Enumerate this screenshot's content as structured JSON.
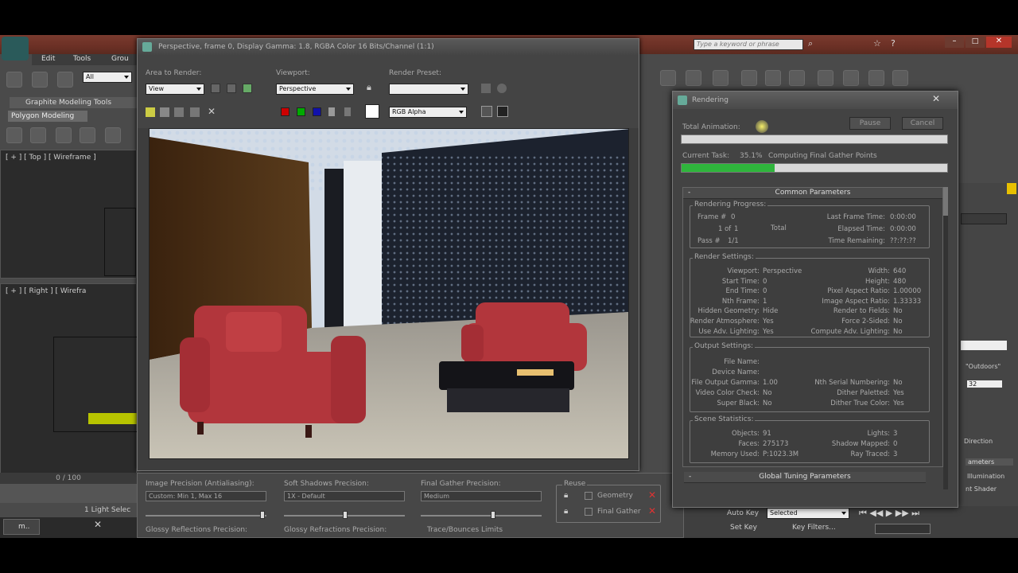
{
  "app": {
    "menu": [
      "Edit",
      "Tools",
      "Grou"
    ],
    "search_placeholder": "Type a keyword or phrase",
    "selection_filter": "All",
    "ribbon_tab": "Graphite Modeling Tools",
    "ribbon_subtab": "Polygon Modeling",
    "viewport_top_label": "[ + ] [ Top ] [ Wireframe ]",
    "viewport_right_label": "[ + ] [ Right ] [ Wirefra",
    "timeline": "0 / 100",
    "status_selected": "1 Light Selec",
    "taskbar_item": "m..",
    "autokey_label": "Auto Key",
    "setkey_label": "Set Key",
    "selected_dropdown": "Selected",
    "key_filters_label": "Key Filters...",
    "right_panel_items": [
      "\"Outdoors\"",
      "32",
      "Direction",
      "ameters",
      "Illumination",
      "nt Shader"
    ]
  },
  "render_frame": {
    "title": "Perspective, frame 0, Display Gamma: 1.8, RGBA Color 16 Bits/Channel (1:1)",
    "area_label": "Area to Render:",
    "area_value": "View",
    "viewport_label": "Viewport:",
    "viewport_value": "Perspective",
    "preset_label": "Render Preset:",
    "preset_value": "",
    "channel_value": "RGB Alpha",
    "image_precision_label": "Image Precision (Antialiasing):",
    "image_precision_value": "Custom: Min 1, Max 16",
    "soft_shadows_label": "Soft Shadows Precision:",
    "soft_shadows_value": "1X - Default",
    "final_gather_label": "Final Gather Precision:",
    "final_gather_value": "Medium",
    "reuse_label": "Reuse",
    "reuse_geometry": "Geometry",
    "reuse_final_gather": "Final Gather",
    "glossy_reflections_label": "Glossy Reflections Precision:",
    "glossy_refractions_label": "Glossy Refractions Precision:",
    "trace_bounces_label": "Trace/Bounces Limits"
  },
  "rendering_dialog": {
    "title": "Rendering",
    "pause_label": "Pause",
    "cancel_label": "Cancel",
    "total_animation_label": "Total Animation:",
    "total_animation_progress": 0.0,
    "current_task_label": "Current Task:",
    "current_task_percent": "35.1%",
    "current_task_name": "Computing Final Gather Points",
    "current_task_progress": 0.35,
    "common_parameters_header": "Common Parameters",
    "global_tuning_header": "Global Tuning Parameters",
    "progress_group": {
      "title": "Rendering Progress:",
      "frame_label": "Frame #",
      "frame_value": "0",
      "of_label": "1 of",
      "of_value": "1",
      "total_label": "Total",
      "pass_label": "Pass #",
      "pass_value": "1/1",
      "last_frame_label": "Last Frame Time:",
      "last_frame_value": "0:00:00",
      "elapsed_label": "Elapsed Time:",
      "elapsed_value": "0:00:00",
      "remaining_label": "Time Remaining:",
      "remaining_value": "??:??:??"
    },
    "render_settings": {
      "title": "Render Settings:",
      "rows_left": [
        {
          "label": "Viewport:",
          "value": "Perspective"
        },
        {
          "label": "Start Time:",
          "value": "0"
        },
        {
          "label": "End Time:",
          "value": "0"
        },
        {
          "label": "Nth Frame:",
          "value": "1"
        },
        {
          "label": "Hidden Geometry:",
          "value": "Hide"
        },
        {
          "label": "Render Atmosphere:",
          "value": "Yes"
        },
        {
          "label": "Use Adv. Lighting:",
          "value": "Yes"
        }
      ],
      "rows_right": [
        {
          "label": "Width:",
          "value": "640"
        },
        {
          "label": "Height:",
          "value": "480"
        },
        {
          "label": "Pixel Aspect Ratio:",
          "value": "1.00000"
        },
        {
          "label": "Image Aspect Ratio:",
          "value": "1.33333"
        },
        {
          "label": "Render to Fields:",
          "value": "No"
        },
        {
          "label": "Force 2-Sided:",
          "value": "No"
        },
        {
          "label": "Compute Adv. Lighting:",
          "value": "No"
        }
      ]
    },
    "output_settings": {
      "title": "Output Settings:",
      "file_name_label": "File Name:",
      "device_name_label": "Device Name:",
      "rows_left": [
        {
          "label": "File Output Gamma:",
          "value": "1.00"
        },
        {
          "label": "Video Color Check:",
          "value": "No"
        },
        {
          "label": "Super Black:",
          "value": "No"
        }
      ],
      "rows_right": [
        {
          "label": "Nth Serial Numbering:",
          "value": "No"
        },
        {
          "label": "Dither Paletted:",
          "value": "Yes"
        },
        {
          "label": "Dither True Color:",
          "value": "Yes"
        }
      ]
    },
    "scene_statistics": {
      "title": "Scene Statistics:",
      "rows_left": [
        {
          "label": "Objects:",
          "value": "91"
        },
        {
          "label": "Faces:",
          "value": "275173"
        },
        {
          "label": "Memory Used:",
          "value": "P:1023.3M"
        }
      ],
      "rows_right": [
        {
          "label": "Lights:",
          "value": "3"
        },
        {
          "label": "Shadow Mapped:",
          "value": "0"
        },
        {
          "label": "Ray Traced:",
          "value": "3"
        }
      ]
    }
  },
  "colors": {
    "title_red": "#6b3025",
    "progress_green": "#2fb53c",
    "sofa_red": "#b2363c"
  }
}
